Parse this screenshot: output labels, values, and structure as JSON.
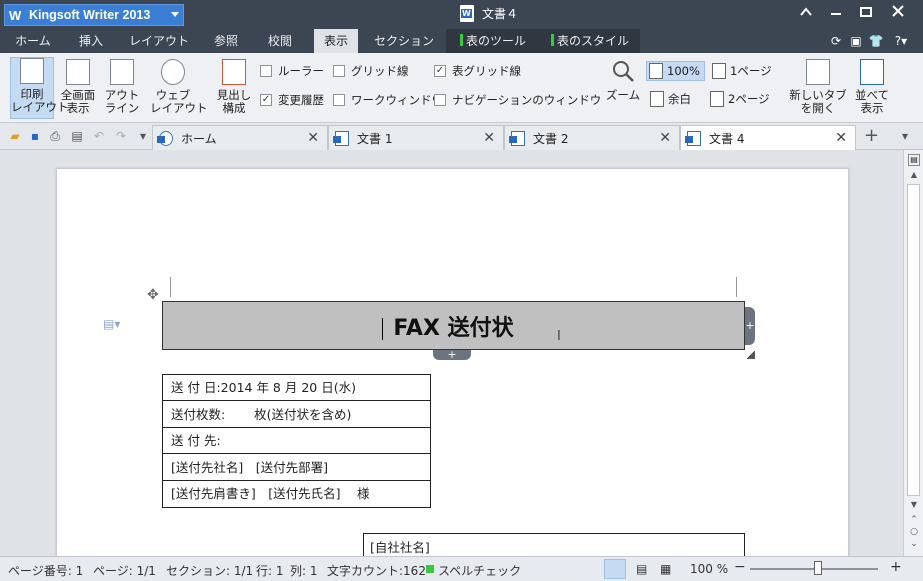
{
  "app": {
    "name": "Kingsoft Writer 2013",
    "document_title": "文書４"
  },
  "menu": {
    "tabs": [
      "ホーム",
      "挿入",
      "レイアウト",
      "参照",
      "校閲",
      "表示",
      "セクション"
    ],
    "active": "表示",
    "context_tabs": [
      "表のツール",
      "表のスタイル"
    ]
  },
  "ribbon": {
    "print_layout": "印刷\nレイアウト",
    "fullscreen": "全画面\n表示",
    "outline": "アウト\nライン",
    "web_layout": "ウェブ\nレイアウト",
    "heading_structure": "見出し\n構成",
    "checkboxes": {
      "ruler": {
        "label": "ルーラー",
        "checked": false
      },
      "gridlines": {
        "label": "グリッド線",
        "checked": false
      },
      "table_gridlines": {
        "label": "表グリッド線",
        "checked": true
      },
      "track_changes": {
        "label": "変更履歴",
        "checked": true
      },
      "work_window": {
        "label": "ワークウィンドウ",
        "checked": false
      },
      "navigation_window": {
        "label": "ナビゲーションのウィンドウ",
        "checked": false
      }
    },
    "zoom": "ズーム",
    "zoom_100": "100%",
    "one_page": "1ページ",
    "margin": "余白",
    "two_pages": "2ページ",
    "new_tab": "新しいタブ\nを開く",
    "arrange": "並べて\n表示"
  },
  "doc_tabs": [
    {
      "label": "ホーム",
      "active": false
    },
    {
      "label": "文書 1",
      "active": false
    },
    {
      "label": "文書 2",
      "active": false
    },
    {
      "label": "文書 4",
      "active": true
    }
  ],
  "document": {
    "heading": "FAX 送付状",
    "info_rows": [
      "送 付 日:2014 年 8 月 20 日(水)",
      "送付枚数:　　 枚(送付状を含め)",
      "送 付 先:",
      "[送付先社名]　[送付先部署]",
      "[送付先肩書き]　[送付先氏名]　 様"
    ],
    "sender_row": "[自社社名]"
  },
  "status": {
    "page_number": "ページ番号: 1",
    "page": "ページ: 1/1",
    "section": "セクション: 1/1",
    "row": "行: 1",
    "col": "列: 1",
    "char_count": "文字カウント:162",
    "spellcheck": "スペルチェック",
    "zoom": "100 %"
  },
  "colors": {
    "titlebar": "#3c4652",
    "accent": "#3a7fd5",
    "heading_fill": "#c0c0c0",
    "context_green": "#3cc83c"
  }
}
